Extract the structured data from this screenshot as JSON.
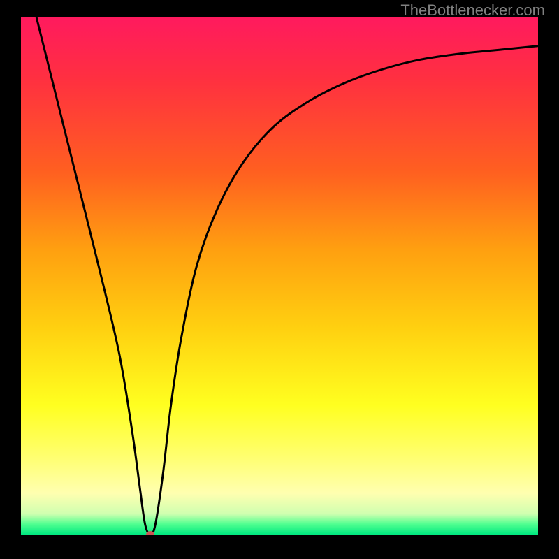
{
  "watermark": "TheBottlenecker.com",
  "chart_data": {
    "type": "line",
    "title": "",
    "xlabel": "",
    "ylabel": "",
    "xlim": [
      0,
      100
    ],
    "ylim": [
      0,
      100
    ],
    "background_gradient": {
      "stops": [
        {
          "offset": 0,
          "color": "#ff1a5e"
        },
        {
          "offset": 12,
          "color": "#ff3040"
        },
        {
          "offset": 30,
          "color": "#ff6020"
        },
        {
          "offset": 45,
          "color": "#ffa010"
        },
        {
          "offset": 60,
          "color": "#ffd010"
        },
        {
          "offset": 75,
          "color": "#ffff20"
        },
        {
          "offset": 85,
          "color": "#ffff70"
        },
        {
          "offset": 92,
          "color": "#ffffb0"
        },
        {
          "offset": 96,
          "color": "#d0ffb0"
        },
        {
          "offset": 98,
          "color": "#50ff90"
        },
        {
          "offset": 100,
          "color": "#00e880"
        }
      ]
    },
    "series": [
      {
        "name": "curve",
        "color": "#000000",
        "x": [
          3,
          7,
          11,
          15,
          19,
          21.5,
          23,
          24,
          25,
          26,
          27.5,
          29,
          31,
          34,
          38,
          43,
          49,
          56,
          63,
          70,
          77,
          85,
          93,
          100
        ],
        "y": [
          100,
          84,
          68,
          52,
          35,
          20,
          9,
          2,
          0,
          2,
          12,
          25,
          38,
          52,
          63,
          72,
          79,
          84,
          87.5,
          90,
          91.8,
          93,
          93.8,
          94.5
        ]
      }
    ],
    "marker": {
      "x": 25,
      "y": 0,
      "color": "#cc5555",
      "rx": 6,
      "ry": 5
    },
    "plot_frame": {
      "inner_border_color": "#000000"
    }
  }
}
